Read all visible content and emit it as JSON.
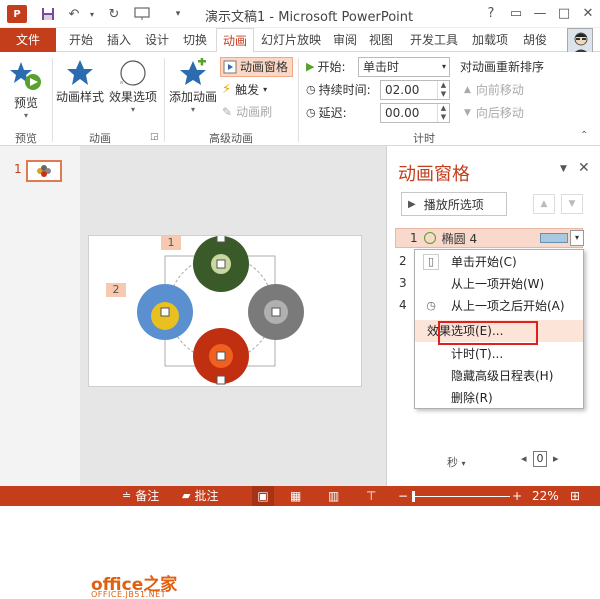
{
  "app": {
    "title": "演示文稿1 - Microsoft PowerPoint",
    "logo_text": "P",
    "window_controls": [
      "?",
      "▭",
      "—",
      "□",
      "✕"
    ]
  },
  "tabs": [
    "文件",
    "开始",
    "插入",
    "设计",
    "切换",
    "动画",
    "幻灯片放映",
    "审阅",
    "视图",
    "开发工具",
    "加载项",
    "胡俊"
  ],
  "ribbon": {
    "preview": {
      "label": "预览",
      "group": "预览"
    },
    "animation_styles": "动画样式",
    "effect_options": "效果选项",
    "animation_group": "动画",
    "add_animation": "添加动画",
    "anim_pane": "动画窗格",
    "trigger": "触发",
    "anim_painter": "动画刷",
    "advanced_group": "高级动画",
    "start_label": "开始:",
    "start_value": "单击时",
    "duration_label": "持续时间:",
    "duration_value": "02.00",
    "delay_label": "延迟:",
    "delay_value": "00.00",
    "timing_group": "计时",
    "reorder_title": "对动画重新排序",
    "move_earlier": "向前移动",
    "move_later": "向后移动"
  },
  "thumbnail": {
    "number": "1"
  },
  "slide": {
    "tags": [
      "1",
      "2"
    ]
  },
  "anim_pane": {
    "title": "动画窗格",
    "play_all": "播放所选项",
    "item": {
      "num": "1",
      "name": "椭圆 4"
    },
    "other_nums": [
      "2",
      "3",
      "4"
    ],
    "timeline_unit": "秒",
    "timeline_value": "0"
  },
  "context_menu": {
    "items": [
      "单击开始(C)",
      "从上一项开始(W)",
      "从上一项之后开始(A)",
      "效果选项(E)...",
      "计时(T)...",
      "隐藏高级日程表(H)",
      "删除(R)"
    ]
  },
  "status": {
    "notes": "备注",
    "comments": "批注",
    "zoom": "22%"
  },
  "watermark": {
    "main": "office之家",
    "sub": "OFFICE.JB51.NET"
  },
  "colors": {
    "accent": "#c43e1c",
    "context_highlight": "#e0201c"
  }
}
